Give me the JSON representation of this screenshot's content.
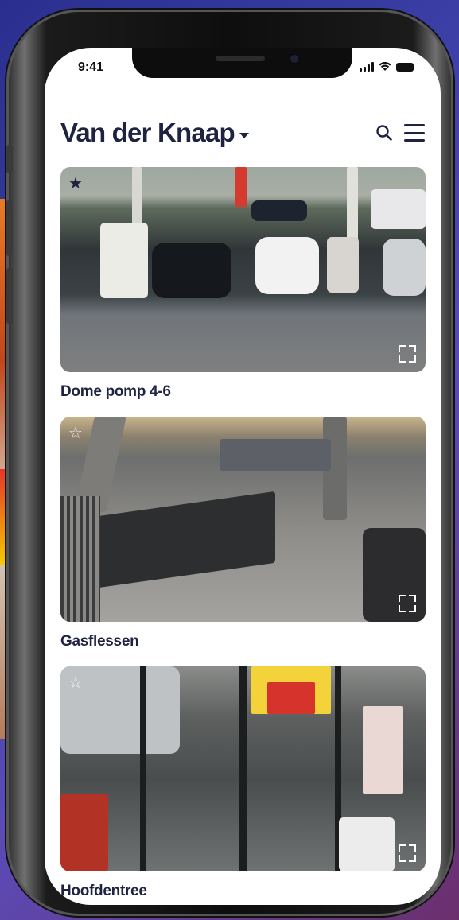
{
  "status_bar": {
    "time": "9:41"
  },
  "header": {
    "title": "Van der Knaap"
  },
  "cameras": [
    {
      "label": "Dome pomp 4-6",
      "favorite": true
    },
    {
      "label": "Gasflessen",
      "favorite": false
    },
    {
      "label": "Hoofdentree",
      "favorite": false
    }
  ],
  "colors": {
    "title": "#1d2340",
    "background": "#ffffff"
  }
}
